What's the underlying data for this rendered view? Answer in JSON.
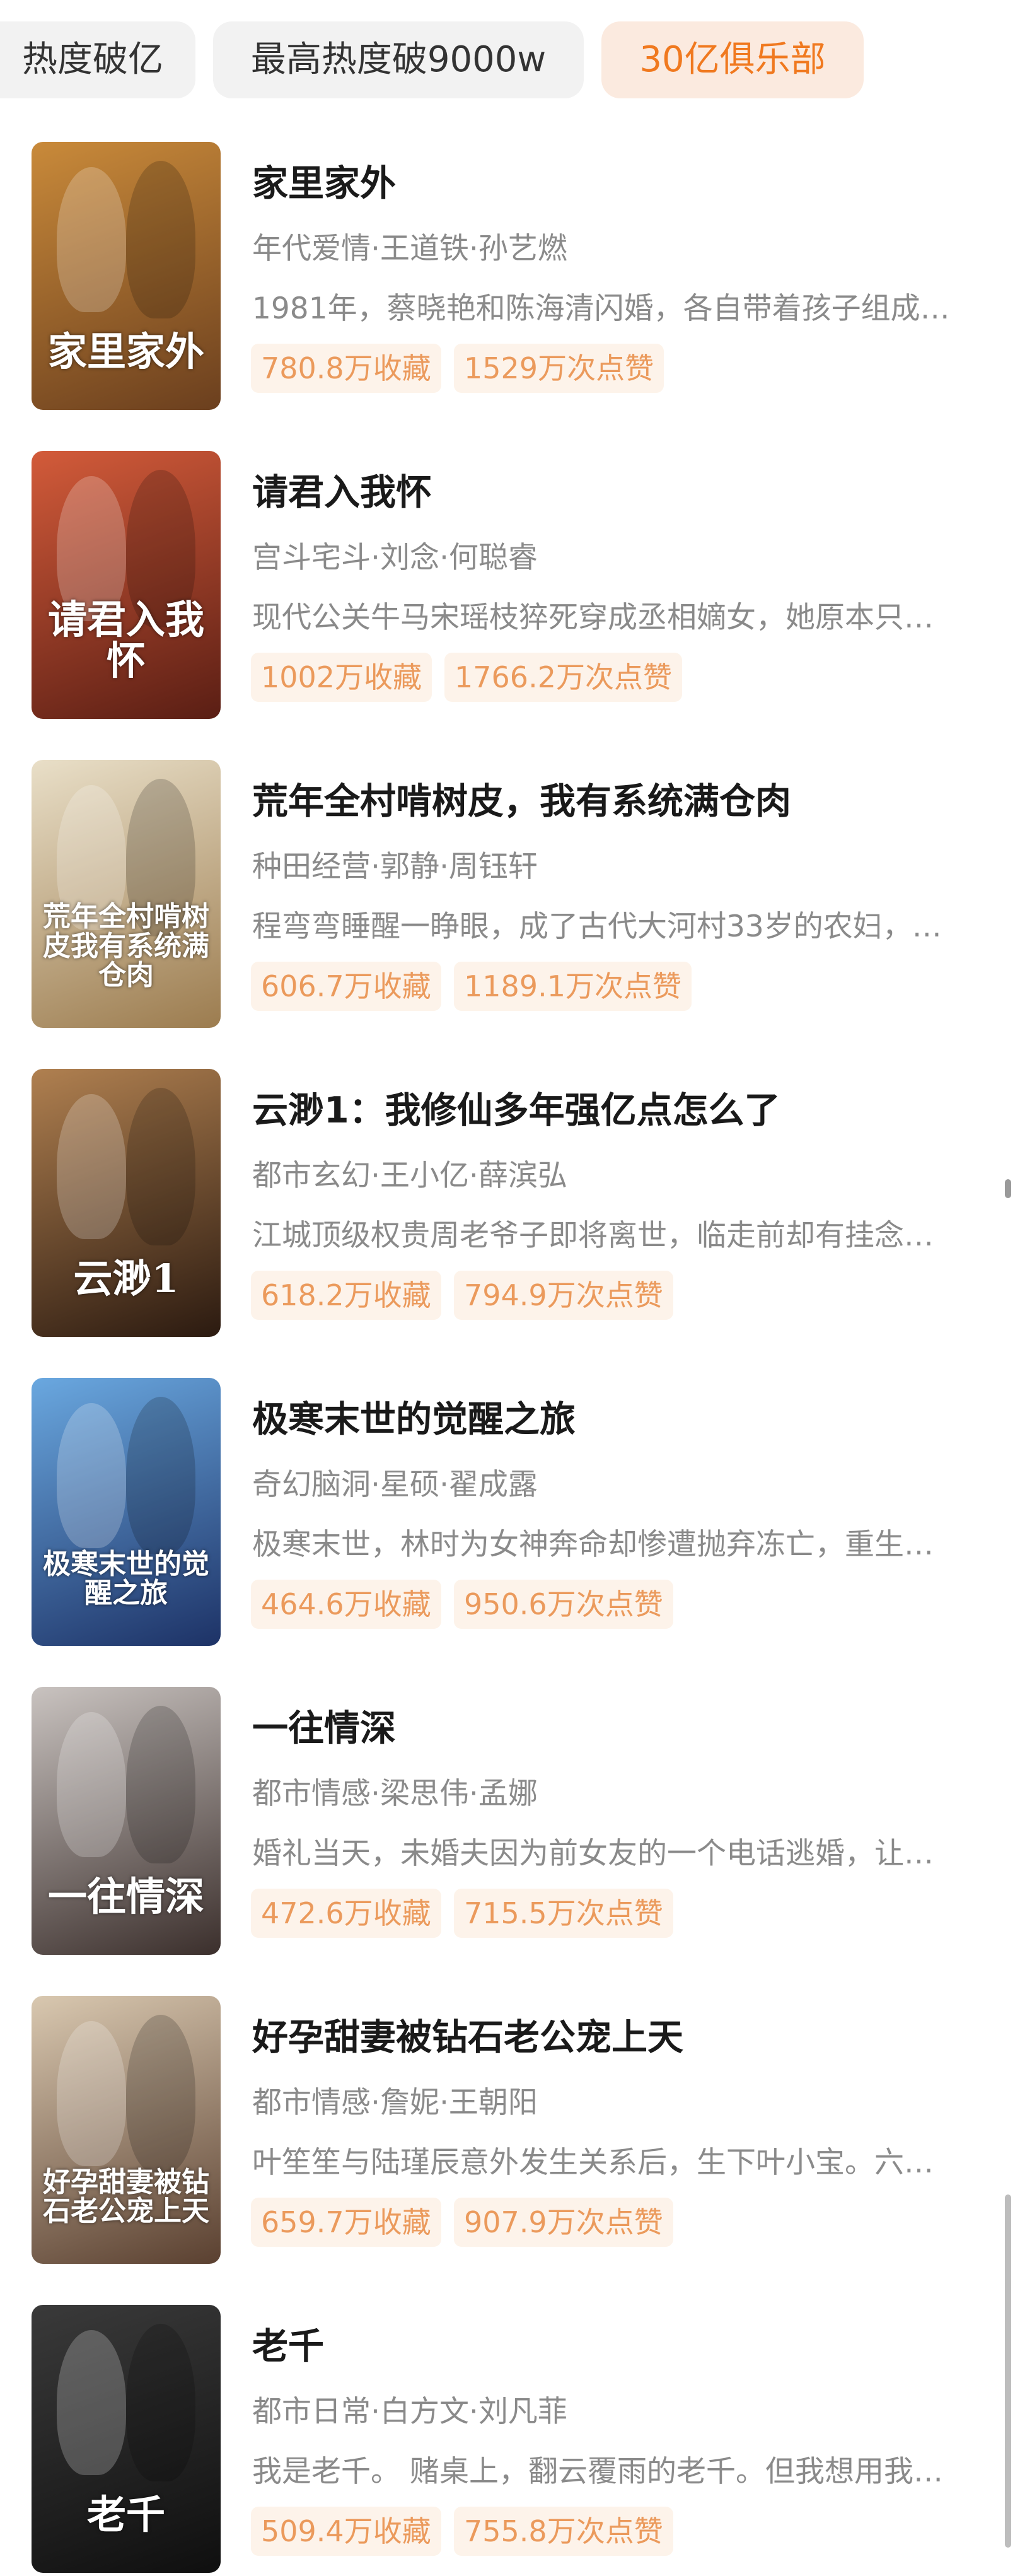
{
  "tabs": [
    "热度破亿",
    "最高热度破9000w",
    "30亿俱乐部"
  ],
  "items": [
    {
      "title": "家里家外",
      "tags": "年代爱情·王道铁·孙艺燃",
      "desc": "1981年，蔡晓艳和陈海清闪婚，各自带着孩子组成…",
      "collect": "780.8万收藏",
      "likes": "1529万次点赞",
      "poster_text": "家里家外",
      "colors": [
        "#c98a3a",
        "#6b3f1e"
      ]
    },
    {
      "title": "请君入我怀",
      "tags": "宫斗宅斗·刘念·何聪睿",
      "desc": "现代公关牛马宋瑶枝猝死穿成丞相嫡女，她原本只…",
      "collect": "1002万收藏",
      "likes": "1766.2万次点赞",
      "poster_text": "请君入我怀",
      "colors": [
        "#d35b3a",
        "#5a1e14"
      ]
    },
    {
      "title": "荒年全村啃树皮，我有系统满仓肉",
      "tags": "种田经营·郭静·周钰轩",
      "desc": "程弯弯睡醒一睁眼，成了古代大河村33岁的农妇，…",
      "collect": "606.7万收藏",
      "likes": "1189.1万次点赞",
      "poster_text": "荒年全村啃树皮我有系统满仓肉",
      "colors": [
        "#e9dfc8",
        "#9c7c4f"
      ]
    },
    {
      "title": "云渺1：我修仙多年强亿点怎么了",
      "tags": "都市玄幻·王小亿·薛滨弘",
      "desc": "江城顶级权贵周老爷子即将离世，临走前却有挂念…",
      "collect": "618.2万收藏",
      "likes": "794.9万次点赞",
      "poster_text": "云渺1",
      "colors": [
        "#b08050",
        "#2b1a10"
      ]
    },
    {
      "title": "极寒末世的觉醒之旅",
      "tags": "奇幻脑洞·星硕·翟成露",
      "desc": "极寒末世，林时为女神奔命却惨遭抛弃冻亡，重生…",
      "collect": "464.6万收藏",
      "likes": "950.6万次点赞",
      "poster_text": "极寒末世的觉醒之旅",
      "colors": [
        "#6aa8e0",
        "#1d3266"
      ]
    },
    {
      "title": "一往情深",
      "tags": "都市情感·梁思伟·孟娜",
      "desc": "婚礼当天，未婚夫因为前女友的一个电话逃婚，让…",
      "collect": "472.6万收藏",
      "likes": "715.5万次点赞",
      "poster_text": "一往情深",
      "colors": [
        "#c9c3c0",
        "#3b2f2c"
      ]
    },
    {
      "title": "好孕甜妻被钻石老公宠上天",
      "tags": "都市情感·詹妮·王朝阳",
      "desc": "叶笙笙与陆瑾辰意外发生关系后，生下叶小宝。六…",
      "collect": "659.7万收藏",
      "likes": "907.9万次点赞",
      "poster_text": "好孕甜妻被钻石老公宠上天",
      "colors": [
        "#d9c8b0",
        "#5a4030"
      ]
    },
    {
      "title": "老千",
      "tags": "都市日常·白方文·刘凡菲",
      "desc": "我是老千。 赌桌上，翻云覆雨的老千。但我想用我…",
      "collect": "509.4万收藏",
      "likes": "755.8万次点赞",
      "poster_text": "老千",
      "colors": [
        "#3a3a3a",
        "#0f0f0f"
      ]
    }
  ]
}
